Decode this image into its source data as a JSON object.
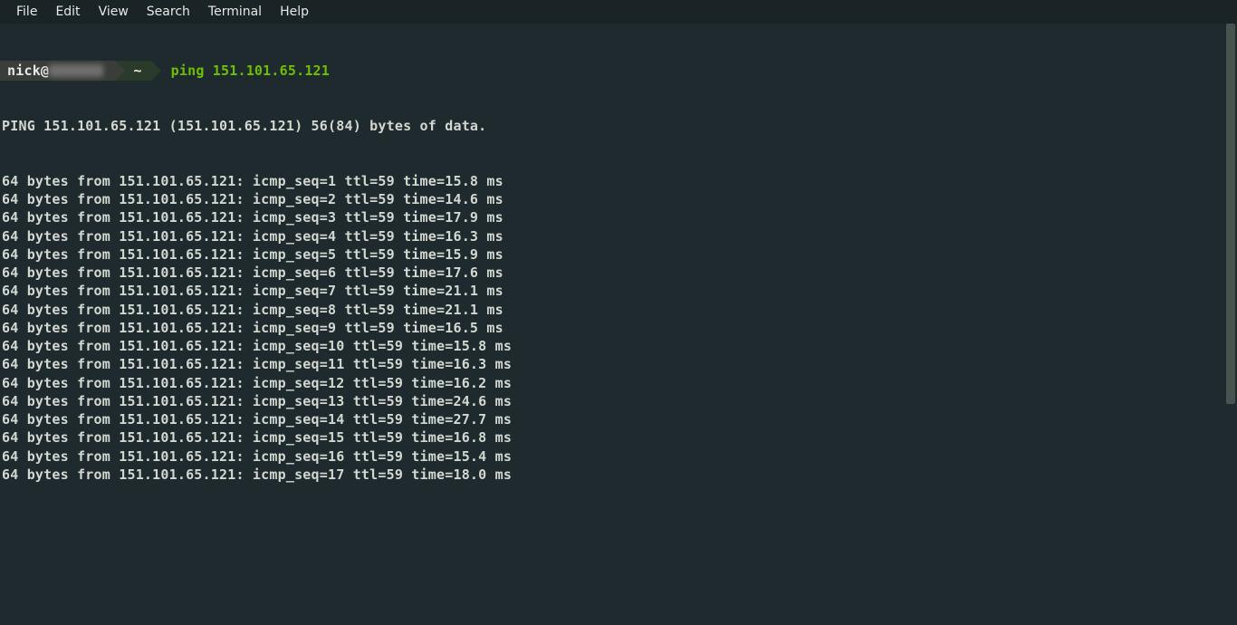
{
  "menu": {
    "items": [
      "File",
      "Edit",
      "View",
      "Search",
      "Terminal",
      "Help"
    ]
  },
  "prompt": {
    "user": "nick@",
    "path": "~",
    "command": "ping 151.101.65.121"
  },
  "header_line": "PING 151.101.65.121 (151.101.65.121) 56(84) bytes of data.",
  "ping": {
    "bytes": 64,
    "from": "151.101.65.121",
    "ttl": 59,
    "responses": [
      {
        "seq": 1,
        "time": "15.8"
      },
      {
        "seq": 2,
        "time": "14.6"
      },
      {
        "seq": 3,
        "time": "17.9"
      },
      {
        "seq": 4,
        "time": "16.3"
      },
      {
        "seq": 5,
        "time": "15.9"
      },
      {
        "seq": 6,
        "time": "17.6"
      },
      {
        "seq": 7,
        "time": "21.1"
      },
      {
        "seq": 8,
        "time": "21.1"
      },
      {
        "seq": 9,
        "time": "16.5"
      },
      {
        "seq": 10,
        "time": "15.8"
      },
      {
        "seq": 11,
        "time": "16.3"
      },
      {
        "seq": 12,
        "time": "16.2"
      },
      {
        "seq": 13,
        "time": "24.6"
      },
      {
        "seq": 14,
        "time": "27.7"
      },
      {
        "seq": 15,
        "time": "16.8"
      },
      {
        "seq": 16,
        "time": "15.4"
      },
      {
        "seq": 17,
        "time": "18.0"
      }
    ]
  }
}
